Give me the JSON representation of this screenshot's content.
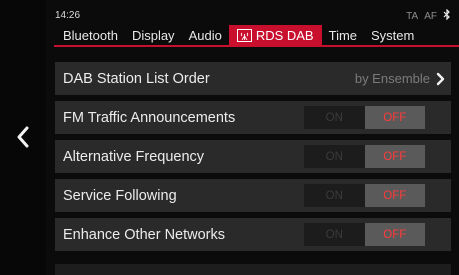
{
  "status": {
    "time": "14:26",
    "ta": "TA",
    "af": "AF",
    "bluetooth_icon": "bluetooth-icon"
  },
  "tabs": [
    {
      "label": "Bluetooth"
    },
    {
      "label": "Display"
    },
    {
      "label": "Audio"
    },
    {
      "label": "RDS DAB",
      "icon": "radio-antenna-icon",
      "active": true
    },
    {
      "label": "Time"
    },
    {
      "label": "System"
    }
  ],
  "settings": {
    "dab_station_list_order": {
      "label": "DAB Station List Order",
      "value": "by Ensemble"
    },
    "fm_traffic": {
      "label": "FM Traffic Announcements",
      "on": "ON",
      "off": "OFF",
      "state": "OFF"
    },
    "alt_freq": {
      "label": "Alternative Frequency",
      "on": "ON",
      "off": "OFF",
      "state": "OFF"
    },
    "service_following": {
      "label": "Service Following",
      "on": "ON",
      "off": "OFF",
      "state": "OFF"
    },
    "enhance_other": {
      "label": "Enhance Other Networks",
      "on": "ON",
      "off": "OFF",
      "state": "OFF"
    }
  },
  "colors": {
    "accent": "#c8102e",
    "off_text": "#ff3b3b",
    "row_bg": "#2a2a2a"
  }
}
